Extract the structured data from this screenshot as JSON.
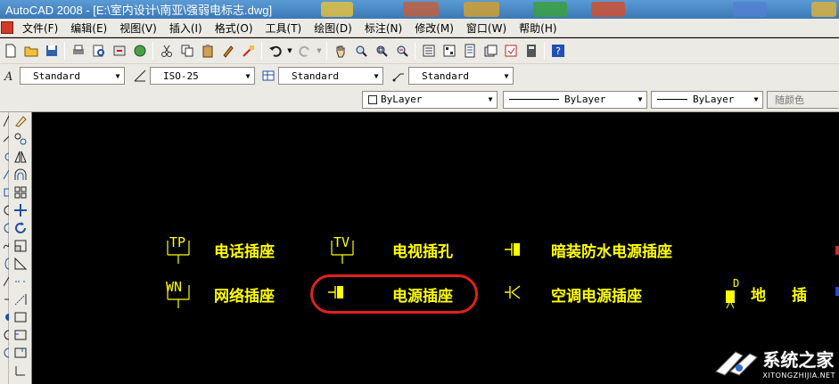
{
  "window": {
    "title": "AutoCAD 2008 - [E:\\室内设计\\南亚\\强弱电标志.dwg]"
  },
  "menu": [
    {
      "id": "file",
      "label": "文件(F)"
    },
    {
      "id": "edit",
      "label": "编辑(E)"
    },
    {
      "id": "view",
      "label": "视图(V)"
    },
    {
      "id": "insert",
      "label": "插入(I)"
    },
    {
      "id": "format",
      "label": "格式(O)"
    },
    {
      "id": "tools",
      "label": "工具(T)"
    },
    {
      "id": "draw",
      "label": "绘图(D)"
    },
    {
      "id": "dimension",
      "label": "标注(N)"
    },
    {
      "id": "modify",
      "label": "修改(M)"
    },
    {
      "id": "window",
      "label": "窗口(W)"
    },
    {
      "id": "help",
      "label": "帮助(H)"
    }
  ],
  "styles": {
    "text_style": "Standard",
    "dim_style": "ISO-25",
    "table_style": "Standard",
    "mleader_style": "Standard"
  },
  "properties": {
    "color": "ByLayer",
    "linetype": "ByLayer",
    "lineweight": "ByLayer",
    "plot_style": "随颜色"
  },
  "drawing": {
    "symbols": {
      "tp": "TP",
      "tv": "TV",
      "wn": "WN",
      "d": "D"
    },
    "labels": {
      "phone_socket": "电话插座",
      "tv_socket": "电视插孔",
      "concealed_waterproof": "暗装防水电源插座",
      "network_socket": "网络插座",
      "power_socket": "电源插座",
      "ac_socket": "空调电源插座",
      "floor_socket_1": "地",
      "floor_socket_2": "插"
    }
  },
  "watermark": {
    "text": "系统之家",
    "sub": "XITONGZHIJIA.NET"
  },
  "colors": {
    "canvas": "#000000",
    "annotation": "#ffff00",
    "highlight": "#e02020"
  }
}
